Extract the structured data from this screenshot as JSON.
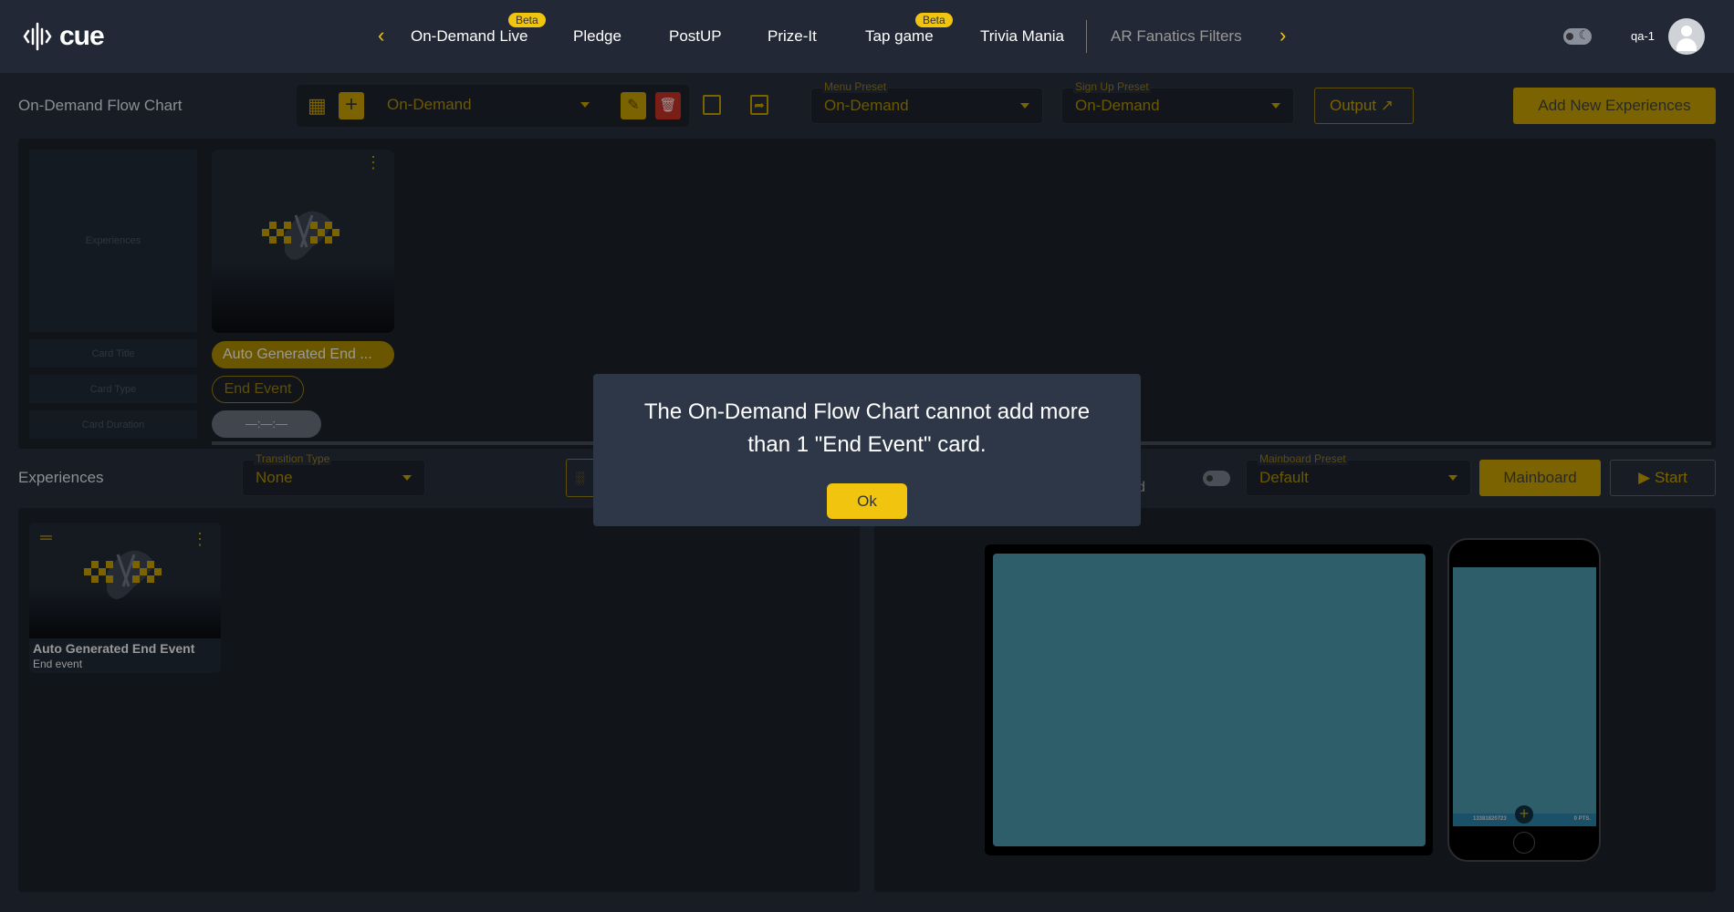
{
  "header": {
    "logo": "cue",
    "nav": [
      {
        "label": "On-Demand Live",
        "badge": "Beta"
      },
      {
        "label": "Pledge"
      },
      {
        "label": "PostUP"
      },
      {
        "label": "Prize-It"
      },
      {
        "label": "Tap game",
        "badge": "Beta"
      },
      {
        "label": "Trivia Mania"
      },
      {
        "label": "AR Fanatics Filters"
      }
    ],
    "user": "qa-1"
  },
  "toolbar": {
    "title": "On-Demand Flow Chart",
    "flow_select": "On-Demand",
    "menu_preset_label": "Menu Preset",
    "menu_preset": "On-Demand",
    "signup_preset_label": "Sign Up Preset",
    "signup_preset": "On-Demand",
    "output": "Output",
    "add_new": "Add New Experiences"
  },
  "flow": {
    "placeholders": {
      "experiences": "Experiences",
      "card_title": "Card Title",
      "card_type": "Card Type",
      "card_duration": "Card Duration"
    },
    "card": {
      "title": "Auto Generated End ...",
      "type": "End Event",
      "duration": "—:—:—"
    }
  },
  "row2": {
    "title": "Experiences",
    "transition_label": "Transition Type",
    "transition": "None",
    "mainboard_preset_label": "Mainboard Preset",
    "mainboard_preset": "Default",
    "mainboard": "Mainboard",
    "start": "Start",
    "hidden_suffix": "d"
  },
  "experience_card": {
    "title": "Auto Generated End Event",
    "subtitle": "End event"
  },
  "phone": {
    "id": "13381820723",
    "points": "0 PTS."
  },
  "dialog": {
    "line1": "The On-Demand Flow Chart cannot add more",
    "line2": "than 1 \"End Event\" card.",
    "ok": "Ok"
  },
  "colors": {
    "accent": "#f1c40f",
    "dialog": "#2d3748",
    "screen": "#2f5e6b"
  }
}
